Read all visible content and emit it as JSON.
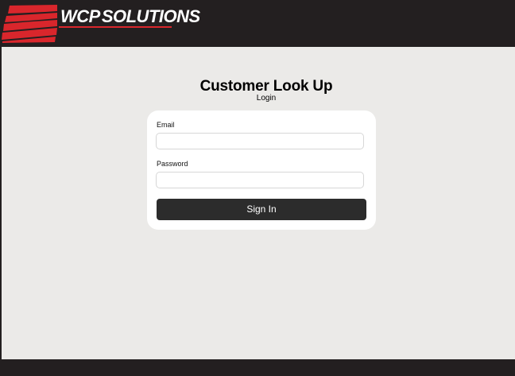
{
  "header": {
    "logo_primary": "WCP",
    "logo_secondary": "SOLUTIONS",
    "brand_colors": {
      "bar": "#231f20",
      "accent": "#d9262c"
    }
  },
  "page": {
    "title": "Customer Look Up",
    "subtitle": "Login"
  },
  "form": {
    "email_label": "Email",
    "email_value": "",
    "password_label": "Password",
    "password_value": "",
    "submit_label": "Sign In"
  }
}
